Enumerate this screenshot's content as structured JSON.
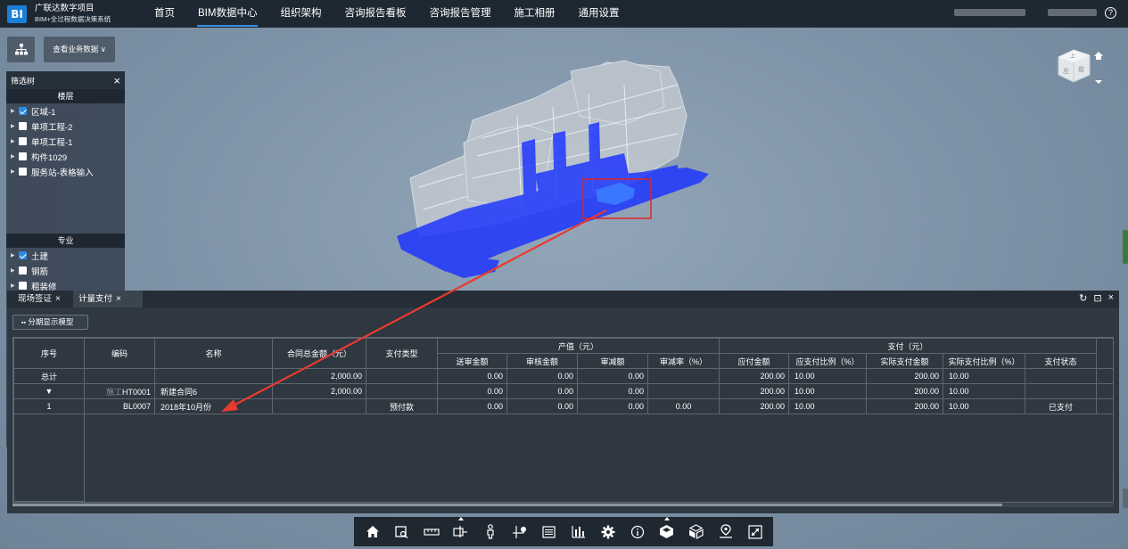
{
  "brand": {
    "logo": "BI",
    "title": "广联达数字项目",
    "subtitle": "BIM+全过程数据决策系统"
  },
  "nav": {
    "items": [
      "首页",
      "BIM数据中心",
      "组织架构",
      "咨询报告看板",
      "咨询报告管理",
      "施工相册",
      "通用设置"
    ],
    "active": "BIM数据中心"
  },
  "help_glyph": "?",
  "toolbar_top": {
    "business_button": "查看业务数据 ∨"
  },
  "filter_tree": {
    "title": "筛选树",
    "close": "×",
    "floor_section": "楼层",
    "floor_items": [
      {
        "label": "区域-1",
        "checked": true
      },
      {
        "label": "单项工程-2",
        "checked": false
      },
      {
        "label": "单项工程-1",
        "checked": false
      },
      {
        "label": "构件1029",
        "checked": false
      },
      {
        "label": "服务站-表格输入",
        "checked": false
      }
    ],
    "discipline_section": "专业",
    "discipline_items": [
      {
        "label": "土建",
        "checked": true
      },
      {
        "label": "钢筋",
        "checked": false
      },
      {
        "label": "粗装修",
        "checked": false
      }
    ]
  },
  "viewcube": {
    "face_top": "上",
    "face_left": "左",
    "face_front": "前"
  },
  "bottom_panel": {
    "tabs": [
      {
        "label": "现场签证",
        "close": "×"
      },
      {
        "label": "计量支付",
        "close": "×"
      }
    ],
    "panel_icons": [
      "↻",
      "⊡",
      "×"
    ],
    "split_button": "分期显示模型",
    "table": {
      "headers_top": {
        "seq": "序号",
        "code": "编码",
        "name": "名称",
        "contract_total": "合同总金额（元）",
        "pay_type": "支付类型",
        "output_group": "产值（元）",
        "payment_group": "支付（元）"
      },
      "headers_sub": {
        "output": [
          "送审金额",
          "审核金额",
          "审减额",
          "审减率（%）"
        ],
        "payment": [
          "应付金额",
          "应支付比例（%）",
          "实际支付金额",
          "实际支付比例（%）",
          "支付状态"
        ]
      },
      "rows": [
        {
          "seq": "总计",
          "code": "",
          "name": "",
          "contract_total": "2,000.00",
          "pay_type": "",
          "submitted": "0.00",
          "audited": "0.00",
          "reduction": "0.00",
          "reduction_rate": "",
          "payable": "200.00",
          "payable_ratio": "10.00",
          "actual_paid": "200.00",
          "actual_ratio": "10.00",
          "status": ""
        },
        {
          "seq": "▼",
          "code": "HT0001",
          "code_prefix": "施工",
          "name": "新建合同6",
          "contract_total": "2,000.00",
          "pay_type": "",
          "submitted": "0.00",
          "audited": "0.00",
          "reduction": "0.00",
          "reduction_rate": "",
          "payable": "200.00",
          "payable_ratio": "10.00",
          "actual_paid": "200.00",
          "actual_ratio": "10.00",
          "status": ""
        },
        {
          "seq": "1",
          "code": "BL0007",
          "name": "2018年10月份",
          "contract_total": "",
          "pay_type": "预付款",
          "submitted": "0.00",
          "audited": "0.00",
          "reduction": "0.00",
          "reduction_rate": "0.00",
          "payable": "200.00",
          "payable_ratio": "10.00",
          "actual_paid": "200.00",
          "actual_ratio": "10.00",
          "status": "已支付"
        }
      ]
    }
  },
  "bottom_toolbar": {
    "icons": [
      "home-icon",
      "zoom-box-icon",
      "measure-ruler-icon",
      "section-box-icon",
      "walk-person-icon",
      "locate-axis-icon",
      "list-icon",
      "chart-icon",
      "settings-gear-icon",
      "info-icon",
      "model-cube-icon",
      "explode-cube-icon",
      "map-pin-icon",
      "fullscreen-icon"
    ]
  },
  "colors": {
    "topbar": "#1e2833",
    "accent": "#3a8fe0",
    "highlight_blue": "#1a32ff",
    "selection_box": "#e02424",
    "arrow": "#e83a2f"
  }
}
